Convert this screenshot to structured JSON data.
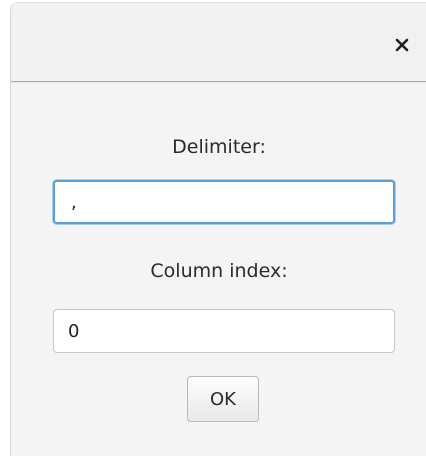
{
  "dialog": {
    "close_icon": "close-icon",
    "delimiter_label": "Delimiter:",
    "delimiter_value": ",",
    "column_index_label": "Column index:",
    "column_index_value": "0",
    "ok_label": "OK"
  },
  "colors": {
    "focus_border": "#5b9fd6",
    "background": "#f4f4f4"
  }
}
